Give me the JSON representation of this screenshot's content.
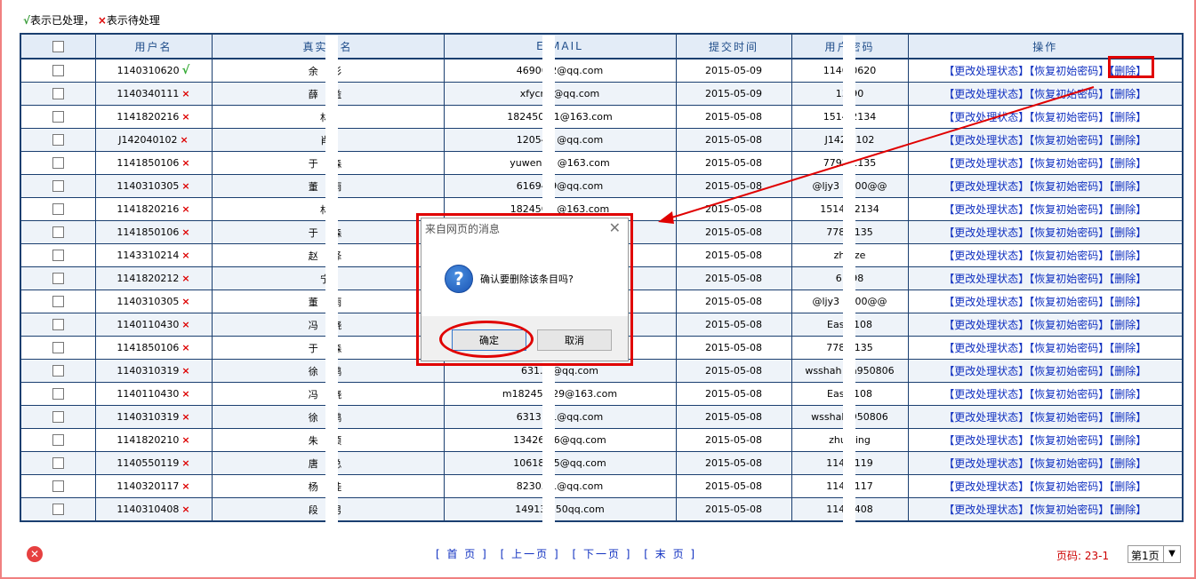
{
  "legend": {
    "ok_symbol": "√",
    "ok_text": "表示已处理，",
    "bad_symbol": "×",
    "bad_text": "表示待处理"
  },
  "columns": [
    "用户名",
    "真实姓名",
    "E-MAIL",
    "提交时间",
    "用户密码",
    "操作"
  ],
  "actions": {
    "change_status": "【更改处理状态】",
    "reset_password": "【恢复初始密码】",
    "delete": "【删除】"
  },
  "rows": [
    {
      "username": "1140310620",
      "status": "ok",
      "name": "余  杉",
      "email": "46900  2@qq.com",
      "date": "2015-05-09",
      "password": "1140  0620"
    },
    {
      "username": "1140340111",
      "status": "bad",
      "name": "薛  益",
      "email": "xfycn(  @qq.com",
      "date": "2015-05-09",
      "password": "13  90"
    },
    {
      "username": "1141820216",
      "status": "bad",
      "name": "林  ",
      "email": "1824503  1@163.com",
      "date": "2015-05-08",
      "password": "1514  2134"
    },
    {
      "username": "J142040102",
      "status": "bad",
      "name": "肖  ",
      "email": "120542  @qq.com",
      "date": "2015-05-08",
      "password": "J142  0102"
    },
    {
      "username": "1141850106",
      "status": "bad",
      "name": "于  森",
      "email": "yuwenmi  @163.com",
      "date": "2015-05-08",
      "password": "7792  1135"
    },
    {
      "username": "1140310305",
      "status": "bad",
      "name": "董  雨",
      "email": "61694  9@qq.com",
      "date": "2015-05-08",
      "password": "@ljy3  0700@@"
    },
    {
      "username": "1141820216",
      "status": "bad",
      "name": "林  ",
      "email": "1824503  @163.com",
      "date": "2015-05-08",
      "password": "1514  62134"
    },
    {
      "username": "1141850106",
      "status": "bad",
      "name": "于  森",
      "email": "",
      "date": "2015-05-08",
      "password": "778  1135"
    },
    {
      "username": "1143310214",
      "status": "bad",
      "name": "赵  泽",
      "email": "",
      "date": "2015-05-08",
      "password": "zh  uze"
    },
    {
      "username": "1141820212",
      "status": "bad",
      "name": "宁  ",
      "email": "",
      "date": "2015-05-08",
      "password": "6  198"
    },
    {
      "username": "1140310305",
      "status": "bad",
      "name": "董  雨",
      "email": "",
      "date": "2015-05-08",
      "password": "@ljy3  0700@@"
    },
    {
      "username": "1140110430",
      "status": "bad",
      "name": "冯  晓",
      "email": "",
      "date": "2015-05-08",
      "password": "Eas  1108"
    },
    {
      "username": "1141850106",
      "status": "bad",
      "name": "于  森",
      "email": "",
      "date": "2015-05-08",
      "password": "778  1135"
    },
    {
      "username": "1140310319",
      "status": "bad",
      "name": "徐  鹏",
      "email": "631.  1@qq.com",
      "date": "2015-05-08",
      "password": "wsshah  ha950806"
    },
    {
      "username": "1140110430",
      "status": "bad",
      "name": "冯  晓",
      "email": "m18245  629@163.com",
      "date": "2015-05-08",
      "password": "Eas  1108"
    },
    {
      "username": "1140310319",
      "status": "bad",
      "name": "徐  鹏",
      "email": "63131  1@qq.com",
      "date": "2015-05-08",
      "password": "wsshah  950806"
    },
    {
      "username": "1141820210",
      "status": "bad",
      "name": "朱  颖",
      "email": "13426  76@qq.com",
      "date": "2015-05-08",
      "password": "zhu  ying"
    },
    {
      "username": "1140550119",
      "status": "bad",
      "name": "唐  总",
      "email": "10618  15@qq.com",
      "date": "2015-05-08",
      "password": "114  0119"
    },
    {
      "username": "1140320117",
      "status": "bad",
      "name": "杨  娃",
      "email": "82303  1@qq.com",
      "date": "2015-05-08",
      "password": "114  0117"
    },
    {
      "username": "1140310408",
      "status": "bad",
      "name": "段  男",
      "email": "14913  450qq.com",
      "date": "2015-05-08",
      "password": "114  0408"
    }
  ],
  "dialog": {
    "title": "来自网页的消息",
    "close": "✕",
    "icon": "?",
    "message": "确认要删除该条目吗?",
    "ok": "确定",
    "cancel": "取消"
  },
  "pager": {
    "first": "[ 首 页 ]",
    "prev": "[ 上一页 ]",
    "next": "[ 下一页 ]",
    "last": "[ 末 页 ]"
  },
  "page_info": "页码: 23-1",
  "page_select": {
    "value": "第1页",
    "arrow": "▼"
  },
  "close_icon": "✕",
  "colors": {
    "header_bg": "#e3ecf7",
    "border": "#1b3f70",
    "link": "#1030c0",
    "highlight": "#e00000"
  }
}
